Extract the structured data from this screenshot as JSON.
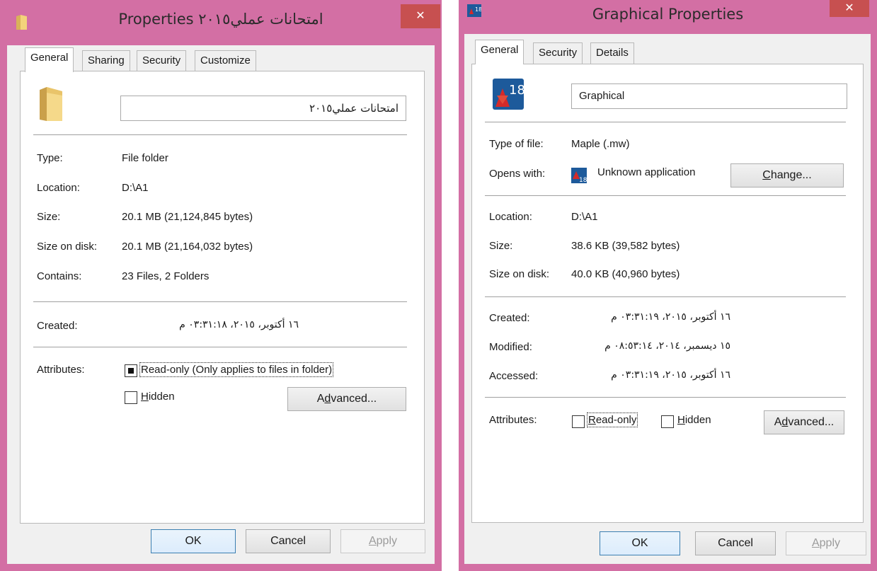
{
  "left": {
    "title": "Properties امتحانات عملي٢٠١٥",
    "close": "✕",
    "icon": "folder-icon",
    "tabs": [
      "General",
      "Sharing",
      "Security",
      "Customize"
    ],
    "name_value": "امتحانات عملي٢٠١٥",
    "rows": [
      {
        "label": "Type:",
        "value": "File folder"
      },
      {
        "label": "Location:",
        "value": "D:\\A1"
      },
      {
        "label": "Size:",
        "value": "20.1 MB (21,124,845 bytes)"
      },
      {
        "label": "Size on disk:",
        "value": "20.1 MB (21,164,032 bytes)"
      },
      {
        "label": "Contains:",
        "value": "23 Files, 2 Folders"
      }
    ],
    "created": {
      "label": "Created:",
      "value": "١٦ أكتوبر، ٢٠١٥، ٠٣:٣١:١٨ م"
    },
    "attributes_label": "Attributes:",
    "readonly_label": "Read-only (Only applies to files in folder)",
    "readonly_state": "indeterminate",
    "hidden_label": "Hidden",
    "hidden_state": "unchecked",
    "advanced": "Advanced...",
    "ok": "OK",
    "cancel": "Cancel",
    "apply": "Apply"
  },
  "right": {
    "title": "Graphical Properties",
    "close": "✕",
    "icon": "maple-18-icon",
    "tabs": [
      "General",
      "Security",
      "Details"
    ],
    "name_value": "Graphical",
    "type_label": "Type of file:",
    "type_value": "Maple (.mw)",
    "opens_label": "Opens with:",
    "opens_value": "Unknown application",
    "change": "Change...",
    "rows": [
      {
        "label": "Location:",
        "value": "D:\\A1"
      },
      {
        "label": "Size:",
        "value": "38.6 KB (39,582 bytes)"
      },
      {
        "label": "Size on disk:",
        "value": "40.0 KB (40,960 bytes)"
      }
    ],
    "dates": [
      {
        "label": "Created:",
        "value": "١٦ أكتوبر، ٢٠١٥، ٠٣:٣١:١٩ م"
      },
      {
        "label": "Modified:",
        "value": "١٥ ديسمبر، ٢٠١٤، ٠٨:٥٣:١٤ م"
      },
      {
        "label": "Accessed:",
        "value": "١٦ أكتوبر، ٢٠١٥، ٠٣:٣١:١٩ م"
      }
    ],
    "attributes_label": "Attributes:",
    "readonly_label": "Read-only",
    "readonly_state": "unchecked",
    "hidden_label": "Hidden",
    "hidden_state": "unchecked",
    "advanced": "Advanced...",
    "ok": "OK",
    "cancel": "Cancel",
    "apply": "Apply"
  },
  "colors": {
    "frame": "#d36fa4",
    "close": "#c75050",
    "surface": "#f0f0f0"
  }
}
